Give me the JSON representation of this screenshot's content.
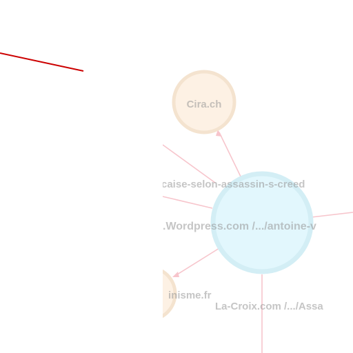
{
  "graph": {
    "nodes": [
      {
        "id": "cira",
        "label": "Cira.ch",
        "fill": "#fdf1e4",
        "stroke": "#f4e3cf"
      },
      {
        "id": "center",
        "label": "",
        "fill": "#e2f7fd",
        "stroke": "#d3eef5"
      },
      {
        "id": "feminisme",
        "label": "inisme.fr",
        "fill": "#fdf1e4",
        "stroke": "#f4e3cf"
      }
    ],
    "labels": {
      "assassin_creed_url": "caise-selon-assassin-s-creed",
      "wordpress_url": ".Wordpress.com /.../antoine-v",
      "lacroix_url": "La-Croix.com /.../Assa"
    },
    "colors": {
      "edge": "#f7c5cc",
      "selection_line": "#cc0000",
      "left_panel": "#ffffff"
    }
  }
}
